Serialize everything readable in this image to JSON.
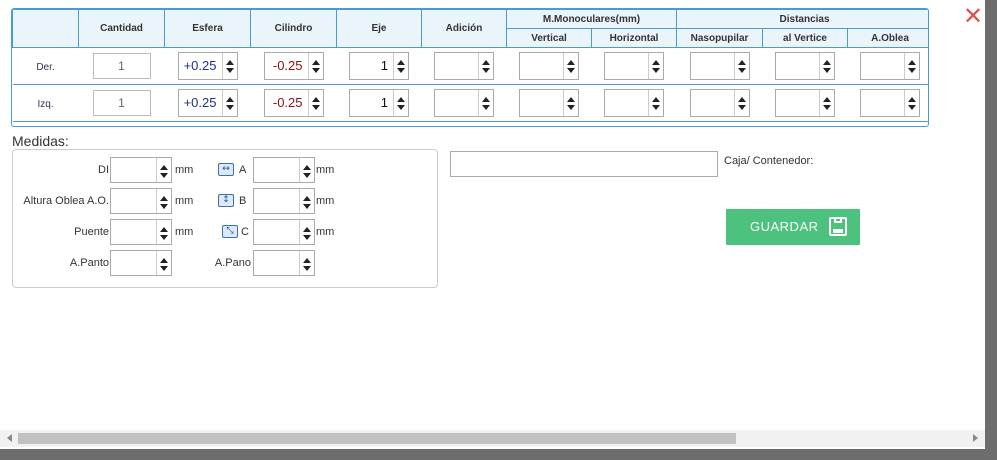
{
  "modal": {
    "close_glyph": "✕"
  },
  "prescription": {
    "columns": {
      "cantidad": "Cantidad",
      "esfera": "Esfera",
      "cilindro": "Cilindro",
      "eje": "Eje",
      "adicion": "Adición",
      "monoculares_group": "M.Monoculares(mm)",
      "vertical": "Vertical",
      "horizontal": "Horizontal",
      "distancias_group": "Distancias",
      "nasopupilar": "Nasopupilar",
      "al_vertice": "al Vertice",
      "a_oblea": "A.Oblea"
    },
    "rows": [
      {
        "label": "Der.",
        "cantidad": "1",
        "esfera": "+0.25",
        "cilindro": "-0.25",
        "eje": "1"
      },
      {
        "label": "Izq.",
        "cantidad": "1",
        "esfera": "+0.25",
        "cilindro": "-0.25",
        "eje": "1"
      }
    ]
  },
  "medidas": {
    "title": "Medidas:",
    "unit": "mm",
    "di_label": "DI",
    "altura_label": "Altura Oblea A.O.",
    "puente_label": "Puente",
    "apanto_label": "A.Panto",
    "a_label": "A",
    "b_label": "B",
    "c_label": "C",
    "apano_label": "A.Pano",
    "icons": {
      "a": "horizontal-arrows-icon",
      "b": "vertical-arrows-icon",
      "c": "diagonal-arrows-icon"
    }
  },
  "caja": {
    "label": "Caja/ Contenedor:",
    "value": ""
  },
  "save": {
    "label": "GUARDAR",
    "icon": "floppy-disk-icon",
    "color": "#4cc27e"
  },
  "colors": {
    "border": "#4a9ccf",
    "header_bg": "#eaf4fb",
    "positive": "#1d2f8f",
    "negative": "#8a1010"
  }
}
